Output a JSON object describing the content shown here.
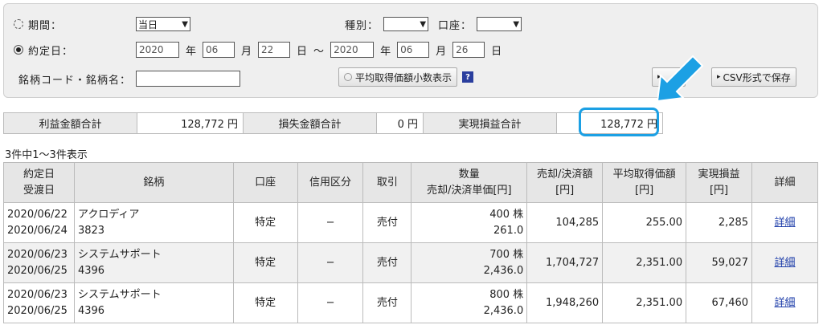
{
  "filter": {
    "period_label": "期間：",
    "period_select": "当日",
    "type_label": "種別：",
    "type_select": "",
    "account_label": "口座：",
    "account_select": "",
    "trade_date_label": "約定日：",
    "from_year": "2020",
    "from_month": "06",
    "from_day": "22",
    "to_year": "2020",
    "to_month": "06",
    "to_day": "26",
    "year_unit": "年",
    "month_unit": "月",
    "day_unit": "日",
    "range_sep": "〜",
    "stock_label": "銘柄コード・銘柄名：",
    "stock_value": "",
    "avg_button": "平均取得価額小数表示",
    "help": "?",
    "csv_button": "CSV形式で保存"
  },
  "summary": {
    "profit_label": "利益金額合計",
    "profit_value": "128,772 円",
    "loss_label": "損失金額合計",
    "loss_value": "0 円",
    "realized_label": "実現損益合計",
    "realized_value": "128,772 円"
  },
  "count_text": "3件中1〜3件表示",
  "table": {
    "headers": {
      "date1": "約定日",
      "date2": "受渡日",
      "stock": "銘柄",
      "account": "口座",
      "credit": "信用区分",
      "trade": "取引",
      "qty1": "数量",
      "qty2": "売却/決済単価[円]",
      "sale1": "売却/決済額",
      "sale2": "[円]",
      "avg1": "平均取得価額",
      "avg2": "[円]",
      "pl1": "実現損益",
      "pl2": "[円]",
      "detail": "詳細"
    },
    "rows": [
      {
        "trade_date": "2020/06/22",
        "settle_date": "2020/06/24",
        "name": "アクロディア",
        "code": "3823",
        "account": "特定",
        "credit": "−",
        "trade": "売付",
        "qty": "400 株",
        "price": "261.0",
        "amount": "104,285",
        "avg": "255.00",
        "pl": "2,285",
        "detail": "詳細"
      },
      {
        "trade_date": "2020/06/23",
        "settle_date": "2020/06/25",
        "name": "システムサポート",
        "code": "4396",
        "account": "特定",
        "credit": "−",
        "trade": "売付",
        "qty": "700 株",
        "price": "2,436.0",
        "amount": "1,704,727",
        "avg": "2,351.00",
        "pl": "59,027",
        "detail": "詳細"
      },
      {
        "trade_date": "2020/06/23",
        "settle_date": "2020/06/25",
        "name": "システムサポート",
        "code": "4396",
        "account": "特定",
        "credit": "−",
        "trade": "売付",
        "qty": "800 株",
        "price": "2,436.0",
        "amount": "1,948,260",
        "avg": "2,351.00",
        "pl": "67,460",
        "detail": "詳細"
      }
    ]
  },
  "colors": {
    "highlight": "#1ca0e4",
    "link": "#1a3aa8"
  }
}
